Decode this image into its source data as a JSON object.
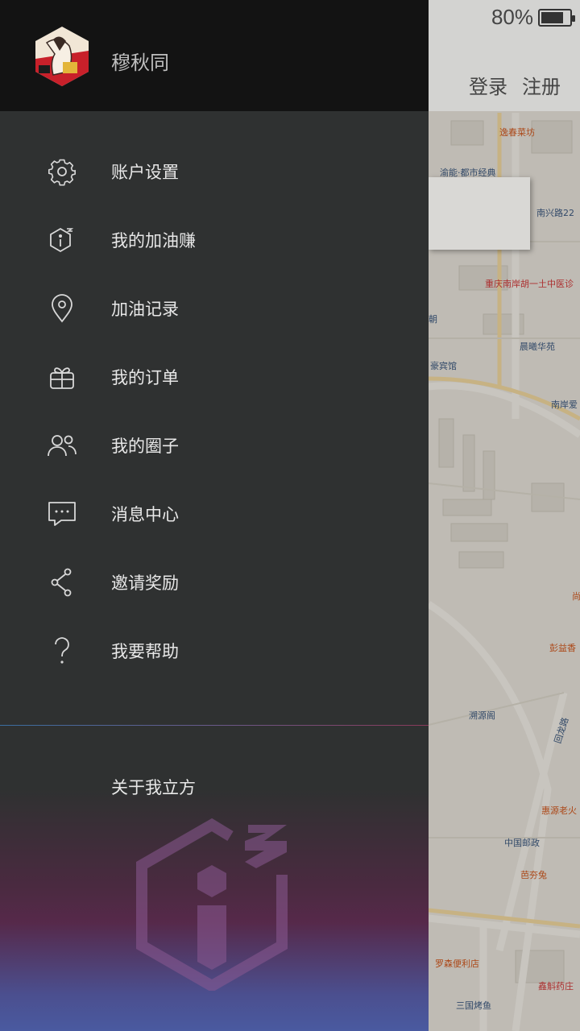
{
  "status_bar": {
    "battery_text": "80%",
    "battery_level": 0.8
  },
  "map_header": {
    "login": "登录",
    "register": "注册"
  },
  "map_labels": {
    "p1": "逸春菜坊",
    "p2": "渝能·都市经典",
    "p3": "南兴路22",
    "p4": "重庆南岸胡一土中医诊",
    "p5": "朝",
    "p6": "晨曦华苑",
    "p7": "豪宾馆",
    "p8": "南岸爱",
    "p9": "尚",
    "p10": "彭益香",
    "p11": "溯源阁",
    "p12": "回龙路",
    "p13": "惠源老火",
    "p14": "中国邮政",
    "p15": "芭夯兔",
    "p16": "罗森便利店",
    "p17": "鑫斛药庄",
    "p18": "三国烤鱼"
  },
  "drawer": {
    "username": "穆秋同",
    "menu": [
      {
        "label": "账户设置",
        "icon": "gear-icon"
      },
      {
        "label": "我的加油赚",
        "icon": "lifang-logo-icon"
      },
      {
        "label": "加油记录",
        "icon": "location-pin-icon"
      },
      {
        "label": "我的订单",
        "icon": "gift-icon"
      },
      {
        "label": "我的圈子",
        "icon": "users-icon"
      },
      {
        "label": "消息中心",
        "icon": "chat-bubble-icon"
      },
      {
        "label": "邀请奖励",
        "icon": "share-icon"
      },
      {
        "label": "我要帮助",
        "icon": "question-mark-icon"
      }
    ],
    "about": "关于我立方"
  },
  "colors": {
    "drawer_bg": "#2f3131",
    "header_bg": "#131313",
    "text": "#e8e8e8"
  }
}
